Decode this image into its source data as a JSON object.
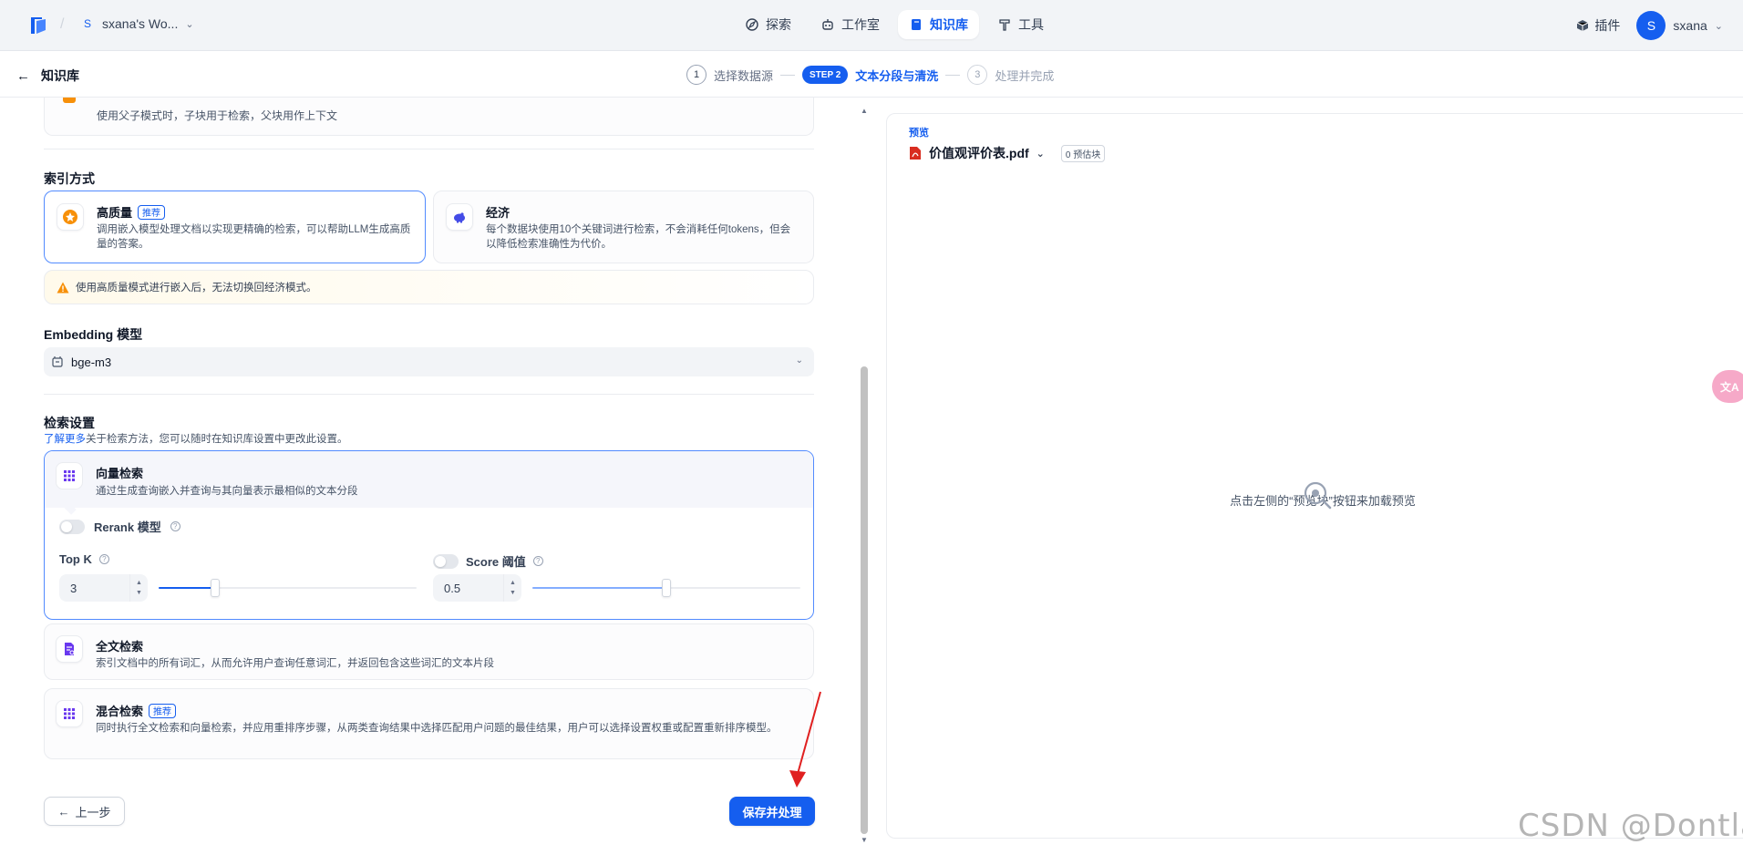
{
  "nav": {
    "workspace": "sxana's Wo...",
    "workspace_badge": "S",
    "items": [
      {
        "label": "探索",
        "icon": "explore-icon"
      },
      {
        "label": "工作室",
        "icon": "robot-icon"
      },
      {
        "label": "知识库",
        "icon": "book-icon",
        "active": true
      },
      {
        "label": "工具",
        "icon": "hammer-icon"
      }
    ],
    "plugins": "插件",
    "user_initial": "S",
    "user_name": "sxana"
  },
  "subheader": {
    "back_label": "知识库",
    "steps": [
      {
        "num": "1",
        "label": "选择数据源"
      },
      {
        "num": "STEP 2",
        "label": "文本分段与清洗"
      },
      {
        "num": "3",
        "label": "处理并完成"
      }
    ]
  },
  "parent_child": {
    "description": "使用父子模式时，子块用于检索，父块用作上下文"
  },
  "index": {
    "title": "索引方式",
    "high_quality": {
      "title": "高质量",
      "tag": "推荐",
      "description": "调用嵌入模型处理文档以实现更精确的检索，可以帮助LLM生成高质量的答案。"
    },
    "economy": {
      "title": "经济",
      "description": "每个数据块使用10个关键词进行检索，不会消耗任何tokens，但会以降低检索准确性为代价。"
    },
    "warning": "使用高质量模式进行嵌入后，无法切换回经济模式。"
  },
  "embedding": {
    "title": "Embedding 模型",
    "model": "bge-m3"
  },
  "retrieval": {
    "title": "检索设置",
    "learn_more": "了解更多",
    "learn_more_suffix": "关于检索方法，您可以随时在知识库设置中更改此设置。",
    "vector": {
      "title": "向量检索",
      "description": "通过生成查询嵌入并查询与其向量表示最相似的文本分段",
      "rerank_label": "Rerank 模型",
      "top_k_label": "Top K",
      "top_k_value": "3",
      "top_k_fraction": 0.22,
      "score_label": "Score 阈值",
      "score_value": "0.5",
      "score_fraction": 0.5
    },
    "fulltext": {
      "title": "全文检索",
      "description": "索引文档中的所有词汇，从而允许用户查询任意词汇，并返回包含这些词汇的文本片段"
    },
    "hybrid": {
      "title": "混合检索",
      "tag": "推荐",
      "description": "同时执行全文检索和向量检索，并应用重排序步骤，从两类查询结果中选择匹配用户问题的最佳结果，用户可以选择设置权重或配置重新排序模型。"
    }
  },
  "buttons": {
    "prev": "上一步",
    "save": "保存并处理"
  },
  "preview": {
    "label": "预览",
    "file": "价值观评价表.pdf",
    "chunks": "0 预估块",
    "empty": "点击左侧的“预览块”按钮来加载预览"
  },
  "watermark": "CSDN @Dontla",
  "colors": {
    "accent": "#155eef",
    "warning": "#f79009",
    "annotation_arrow": "#e02020"
  }
}
